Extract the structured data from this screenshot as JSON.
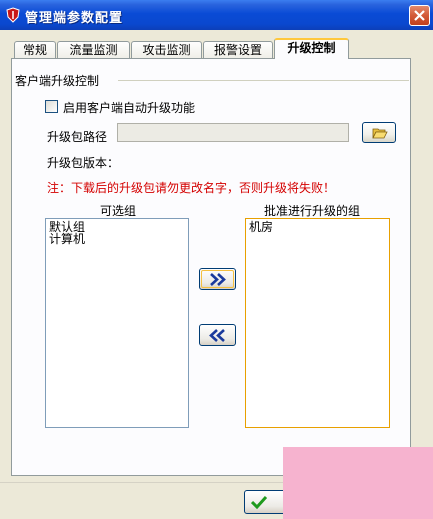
{
  "window": {
    "title": "管理端参数配置"
  },
  "tabs": [
    {
      "label": "常规"
    },
    {
      "label": "流量监测"
    },
    {
      "label": "攻击监测"
    },
    {
      "label": "报警设置"
    },
    {
      "label": "升级控制",
      "active": true
    }
  ],
  "upgrade": {
    "group_title": "客户端升级控制",
    "enable_auto_upgrade_label": "启用客户端自动升级功能",
    "enable_auto_upgrade_checked": false,
    "package_path_label": "升级包路径",
    "package_path_value": "",
    "package_version_label": "升级包版本：",
    "package_version_value": "",
    "warning": "注：下载后的升级包请勿更改名字，否则升级将失败！",
    "warning_color": "#d40000",
    "available_groups_label": "可选组",
    "available_groups": [
      "默认组",
      "计算机"
    ],
    "approved_groups_label": "批准进行升级的组",
    "approved_groups": [
      "机房"
    ]
  },
  "icons": {
    "app": "shield-icon",
    "close": "close-icon",
    "browse": "folder-open-icon",
    "move_right": "double-chevron-right-icon",
    "move_left": "double-chevron-left-icon",
    "ok": "checkmark-icon"
  },
  "colors": {
    "titlebar": "#0a4bd6",
    "active_tab_accent": "#ffc83c",
    "dialog_bg": "#ece9d8",
    "approved_list_border": "#e8a000"
  }
}
